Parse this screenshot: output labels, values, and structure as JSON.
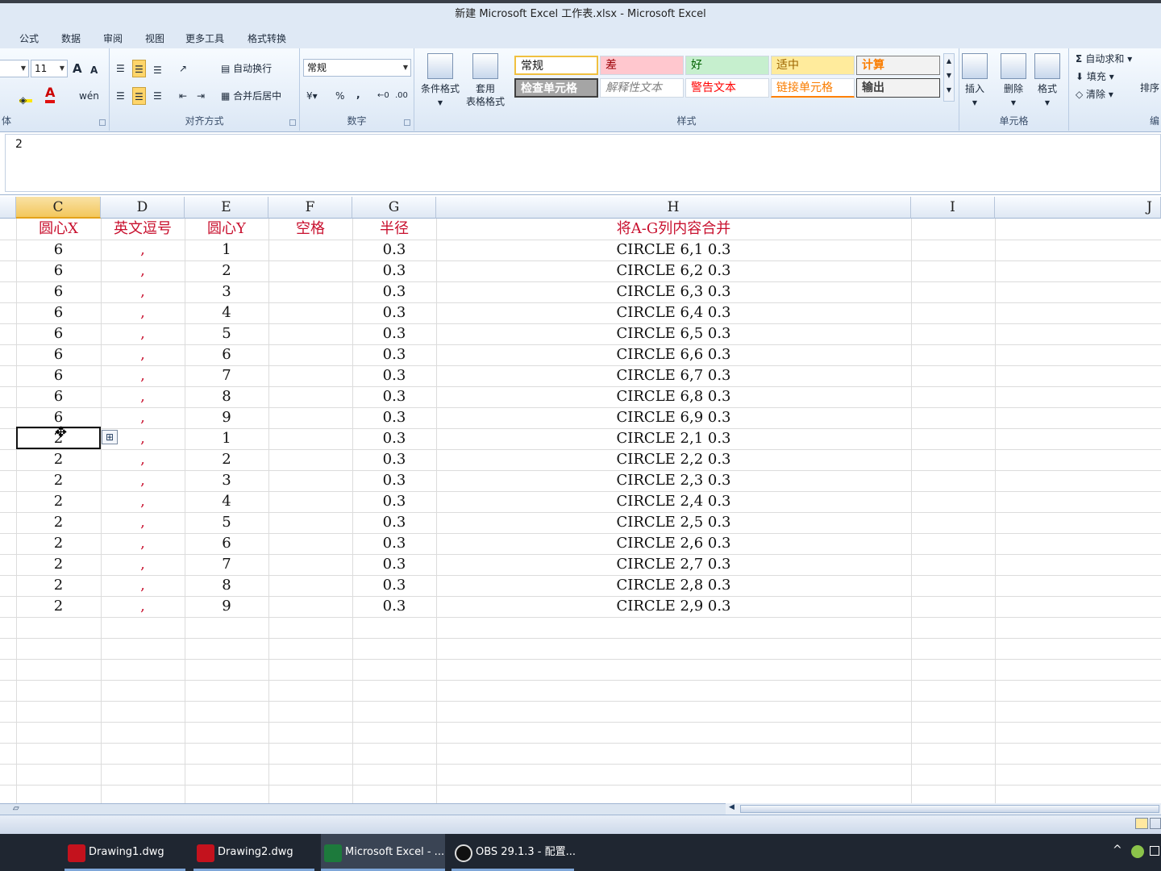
{
  "window": {
    "title": "新建 Microsoft Excel 工作表.xlsx - Microsoft Excel"
  },
  "menu": [
    "公式",
    "数据",
    "审阅",
    "视图",
    "更多工具",
    "格式转换"
  ],
  "ribbon": {
    "font_size": "11",
    "font_grow": "A",
    "font_shrink": "A",
    "wrap_text": "自动换行",
    "merge_center": "合并后居中",
    "number_format": "常规",
    "percent": "%",
    "comma": ",",
    "cond_format": "条件格式",
    "table_format_1": "套用",
    "table_format_2": "表格格式",
    "styles": {
      "normal": "常规",
      "bad": "差",
      "good": "好",
      "neutral": "适中",
      "calc": "计算",
      "check": "检查单元格",
      "explain": "解释性文本",
      "warning": "警告文本",
      "linked": "链接单元格",
      "output": "输出"
    },
    "insert": "插入",
    "delete": "删除",
    "format": "格式",
    "autosum": "自动求和",
    "fill": "填充",
    "clear": "清除",
    "sort": "排序",
    "groups": {
      "font": "体",
      "alignment": "对齐方式",
      "number": "数字",
      "styles": "样式",
      "cells": "单元格",
      "editing": "编"
    }
  },
  "formula_bar": {
    "value": "2"
  },
  "columns": [
    "C",
    "D",
    "E",
    "F",
    "G",
    "H",
    "I",
    "J"
  ],
  "header_row": {
    "c": "圆心X",
    "d": "英文逗号",
    "e": "圆心Y",
    "f": "空格",
    "g": "半径",
    "h": "将A-G列内容合并"
  },
  "rows": [
    {
      "c": "6",
      "d": ",",
      "e": "1",
      "g": "0.3",
      "h": "CIRCLE 6,1 0.3"
    },
    {
      "c": "6",
      "d": ",",
      "e": "2",
      "g": "0.3",
      "h": "CIRCLE 6,2 0.3"
    },
    {
      "c": "6",
      "d": ",",
      "e": "3",
      "g": "0.3",
      "h": "CIRCLE 6,3 0.3"
    },
    {
      "c": "6",
      "d": ",",
      "e": "4",
      "g": "0.3",
      "h": "CIRCLE 6,4 0.3"
    },
    {
      "c": "6",
      "d": ",",
      "e": "5",
      "g": "0.3",
      "h": "CIRCLE 6,5 0.3"
    },
    {
      "c": "6",
      "d": ",",
      "e": "6",
      "g": "0.3",
      "h": "CIRCLE 6,6 0.3"
    },
    {
      "c": "6",
      "d": ",",
      "e": "7",
      "g": "0.3",
      "h": "CIRCLE 6,7 0.3"
    },
    {
      "c": "6",
      "d": ",",
      "e": "8",
      "g": "0.3",
      "h": "CIRCLE 6,8 0.3"
    },
    {
      "c": "6",
      "d": ",",
      "e": "9",
      "g": "0.3",
      "h": "CIRCLE 6,9 0.3"
    },
    {
      "c": "2",
      "d": ",",
      "e": "1",
      "g": "0.3",
      "h": "CIRCLE 2,1 0.3"
    },
    {
      "c": "2",
      "d": ",",
      "e": "2",
      "g": "0.3",
      "h": "CIRCLE 2,2 0.3"
    },
    {
      "c": "2",
      "d": ",",
      "e": "3",
      "g": "0.3",
      "h": "CIRCLE 2,3 0.3"
    },
    {
      "c": "2",
      "d": ",",
      "e": "4",
      "g": "0.3",
      "h": "CIRCLE 2,4 0.3"
    },
    {
      "c": "2",
      "d": ",",
      "e": "5",
      "g": "0.3",
      "h": "CIRCLE 2,5 0.3"
    },
    {
      "c": "2",
      "d": ",",
      "e": "6",
      "g": "0.3",
      "h": "CIRCLE 2,6 0.3"
    },
    {
      "c": "2",
      "d": ",",
      "e": "7",
      "g": "0.3",
      "h": "CIRCLE 2,7 0.3"
    },
    {
      "c": "2",
      "d": ",",
      "e": "8",
      "g": "0.3",
      "h": "CIRCLE 2,8 0.3"
    },
    {
      "c": "2",
      "d": ",",
      "e": "9",
      "g": "0.3",
      "h": "CIRCLE 2,9 0.3"
    }
  ],
  "taskbar": [
    "Drawing1.dwg",
    "Drawing2.dwg",
    "Microsoft Excel - ...",
    "OBS 29.1.3 - 配置..."
  ],
  "colors": {
    "header_text": "#c8102e",
    "active_column": "#f3c75c",
    "ribbon_bg": "#dfe9f5"
  }
}
